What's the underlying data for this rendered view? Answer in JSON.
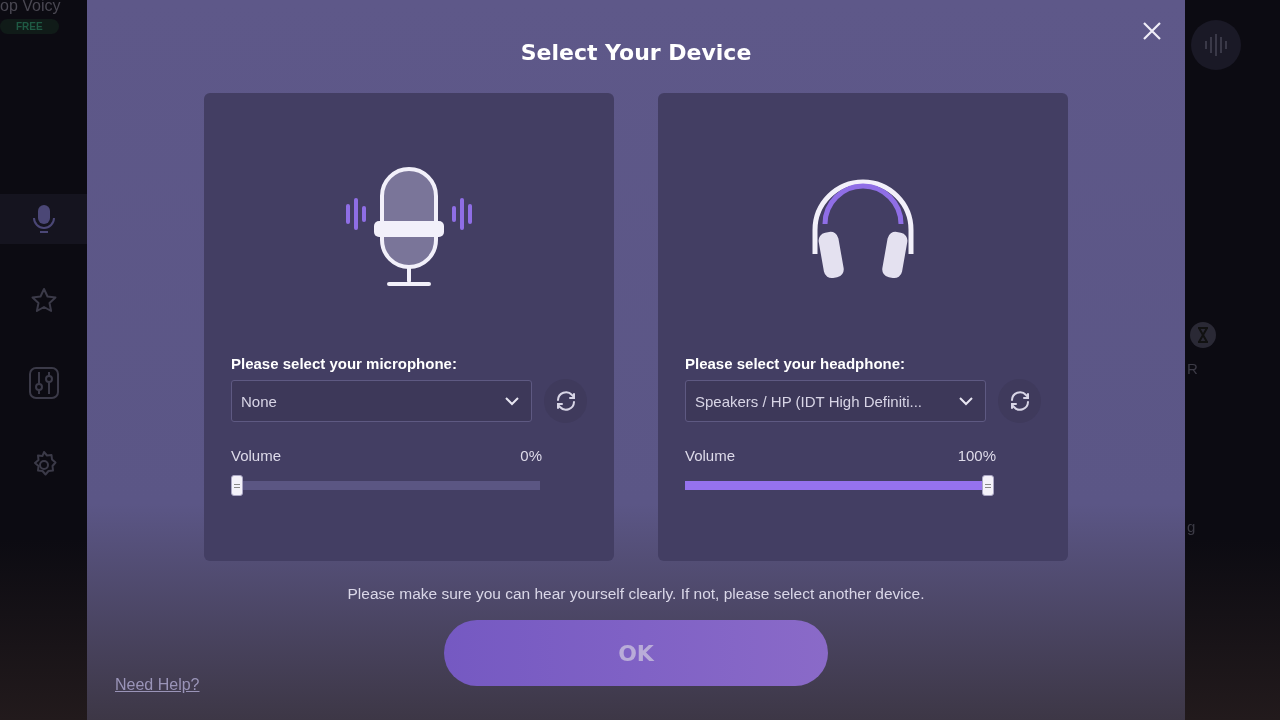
{
  "app": {
    "title": "op Voicy",
    "badge": "FREE",
    "sidebar": [
      {
        "kind": "microphone",
        "selected": true
      },
      {
        "kind": "star",
        "selected": false
      },
      {
        "kind": "mixer",
        "selected": false
      },
      {
        "kind": "settings",
        "selected": false
      }
    ],
    "right_texts": [
      "R",
      "g"
    ]
  },
  "dialog": {
    "title": "Select Your Device",
    "cards": [
      {
        "kind": "microphone",
        "label": "Please select your microphone:",
        "value": "None",
        "volume_label": "Volume",
        "reading": "0%",
        "level": 0
      },
      {
        "kind": "headphone",
        "label": "Please select your headphone:",
        "value": "Speakers / HP (IDT High Definiti...",
        "volume_label": "Volume",
        "reading": "100%",
        "level": 1
      }
    ],
    "note": "Please make sure you can hear yourself clearly. If not, please select another device.",
    "ok_button": "OK",
    "help_link": "Need Help?"
  }
}
